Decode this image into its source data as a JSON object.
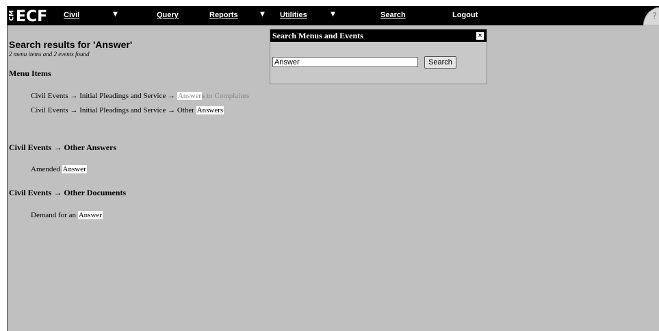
{
  "logo": {
    "cm": "CM",
    "ecf": "ECF"
  },
  "nav": {
    "civil": "Civil",
    "query": "Query",
    "reports": "Reports",
    "utilities": "Utilities",
    "search": "Search",
    "logout": "Logout"
  },
  "results": {
    "title": "Search results for 'Answer'",
    "summary": "2 menu items and 2 events found",
    "menu_items_heading": "Menu Items",
    "menu_items": [
      {
        "prefix": "Civil Events → Initial Pleadings and Service → ",
        "match": "Answer",
        "suffix": "s to Complaints"
      },
      {
        "prefix": "Civil Events → Initial Pleadings and Service → Other ",
        "match": "Answers",
        "suffix": ""
      }
    ],
    "event_groups": [
      {
        "heading": "Civil Events → Other Answers",
        "item": {
          "prefix": "Amended ",
          "match": "Answer",
          "suffix": ""
        }
      },
      {
        "heading": "Civil Events → Other Documents",
        "item": {
          "prefix": "Demand for an ",
          "match": "Answer",
          "suffix": ""
        }
      }
    ]
  },
  "popup": {
    "title": "Search Menus and Events",
    "close": "×",
    "input_value": "Answer",
    "button_label": "Search"
  }
}
